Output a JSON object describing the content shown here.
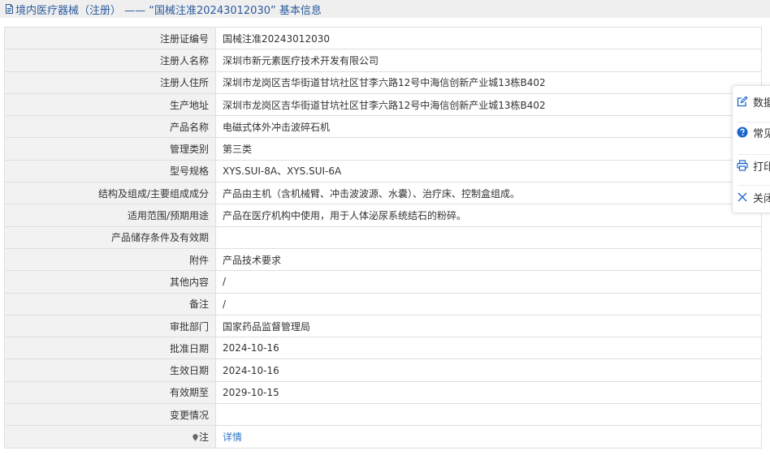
{
  "header": {
    "title": "境内医疗器械（注册） ——  “国械注准20243012030” 基本信息",
    "color": "#2a5a9c"
  },
  "rows": [
    {
      "label": "注册证编号",
      "value": "国械注准20243012030"
    },
    {
      "label": "注册人名称",
      "value": "深圳市新元素医疗技术开发有限公司"
    },
    {
      "label": "注册人住所",
      "value": "深圳市龙岗区吉华街道甘坑社区甘李六路12号中海信创新产业城13栋B402"
    },
    {
      "label": "生产地址",
      "value": "深圳市龙岗区吉华街道甘坑社区甘李六路12号中海信创新产业城13栋B402"
    },
    {
      "label": "产品名称",
      "value": "电磁式体外冲击波碎石机"
    },
    {
      "label": "管理类别",
      "value": "第三类"
    },
    {
      "label": "型号规格",
      "value": "XYS.SUI-8A、XYS.SUI-6A"
    },
    {
      "label": "结构及组成/主要组成成分",
      "value": "产品由主机（含机械臂、冲击波波源、水囊）、治疗床、控制盒组成。"
    },
    {
      "label": "适用范围/预期用途",
      "value": "产品在医疗机构中使用，用于人体泌尿系统结石的粉碎。"
    },
    {
      "label": "产品储存条件及有效期",
      "value": ""
    },
    {
      "label": "附件",
      "value": "产品技术要求"
    },
    {
      "label": "其他内容",
      "value": "/"
    },
    {
      "label": "备注",
      "value": "/"
    },
    {
      "label": "审批部门",
      "value": "国家药品监督管理局"
    },
    {
      "label": "批准日期",
      "value": "2024-10-16"
    },
    {
      "label": "生效日期",
      "value": "2024-10-16"
    },
    {
      "label": "有效期至",
      "value": "2029-10-15"
    },
    {
      "label": "变更情况",
      "value": ""
    }
  ],
  "note_row": {
    "label": "注",
    "icon": "pin-icon",
    "link": "详情",
    "link_color": "#2f76c9"
  },
  "side_panel": {
    "items": [
      {
        "label": "数据",
        "icon": "edit-icon"
      },
      {
        "label": "常见",
        "icon": "question-icon"
      },
      {
        "label": "打印",
        "icon": "print-icon"
      },
      {
        "label": "关闭",
        "icon": "close-icon"
      }
    ],
    "accent": "#1a66cc"
  }
}
